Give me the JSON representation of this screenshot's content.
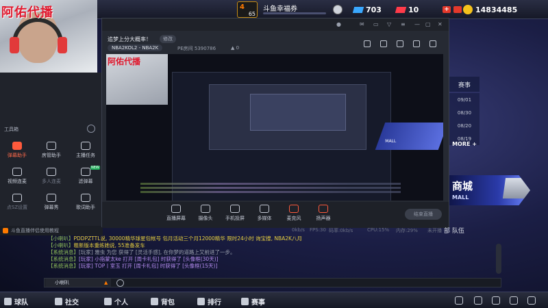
{
  "topbar": {
    "level": "65",
    "event_title": "斗鱼幸福券",
    "stat_blue": "703",
    "stat_red": "10",
    "coins": "14834485",
    "colors": {
      "coin": "#f4c21c",
      "ticket_blue": "#3aa8ff",
      "ticket_red": "#ff3b4a"
    }
  },
  "facecam": {
    "overlay_text": "阿佑代播"
  },
  "tool_panel": {
    "header": "工具箱",
    "tools": [
      {
        "label": "弹幕助手",
        "icon": "danmaku-icon",
        "highlight": true,
        "tag": ""
      },
      {
        "label": "房管助手",
        "icon": "admin-icon",
        "highlight": false,
        "tag": ""
      },
      {
        "label": "主播任务",
        "icon": "task-icon",
        "highlight": false,
        "tag": ""
      },
      {
        "label": "视频连麦",
        "icon": "video-link-icon",
        "highlight": false,
        "tag": ""
      },
      {
        "label": "多人连麦",
        "icon": "multi-link-icon",
        "highlight": false,
        "tag": "",
        "dim": true
      },
      {
        "label": "滤弹幕",
        "icon": "filter-icon",
        "highlight": false,
        "tag": "NEW"
      },
      {
        "label": "点SZ设置",
        "icon": "settings-icon",
        "highlight": false,
        "tag": "",
        "dim": true
      },
      {
        "label": "弹幕秀",
        "icon": "show-icon",
        "highlight": false,
        "tag": ""
      },
      {
        "label": "歌词助手",
        "icon": "lyrics-icon",
        "highlight": false,
        "tag": ""
      }
    ],
    "tipbar": "斗鱼直播伴侣使用教程"
  },
  "stream_window": {
    "room_title": "追梦上分大概率！",
    "edit_label": "修改",
    "category": "NBA2KOL2 - NBA2K",
    "room_id_label": "PE房间",
    "room_id": "5390786",
    "heat": "0",
    "toolbar": [
      {
        "label": "直播屏幕",
        "icon": "screen-icon"
      },
      {
        "label": "摄像头",
        "icon": "camera-icon"
      },
      {
        "label": "手机投屏",
        "icon": "phone-cast-icon"
      },
      {
        "label": "多媒体",
        "icon": "media-icon"
      },
      {
        "label": "麦克风",
        "icon": "mic-icon"
      },
      {
        "label": "扬声器",
        "icon": "speaker-icon"
      }
    ],
    "start_label": "结束直播"
  },
  "game_right": {
    "tab_label": "赛事",
    "dates": [
      "09/01",
      "08/30",
      "08/20",
      "08/19"
    ],
    "more_label": "MORE +",
    "mall_title": "商城",
    "mall_sub": "MALL",
    "preview_mall": "MALL"
  },
  "status_row": {
    "net": "0kb/s",
    "fps": "FPS:30",
    "bitrate": "码率:0kb/s",
    "cpu": "CPU:15%",
    "mem": "内存:29%",
    "state": "未开播",
    "teams": "部 队伍"
  },
  "chat": {
    "lines": [
      {
        "tag": "【小喇叭】",
        "tag_class": "tag-user",
        "text": "PDDPZTTL说, 30000精华球星包帐号 包月活动三个月12000精华 限时24小时 询宝搜, NBA2K八月",
        "cls": "msg-yellow"
      },
      {
        "tag": "【小喇叭】",
        "tag_class": "tag-user",
        "text": "粗新版本重练她说, 55准备发车",
        "cls": "msg-yellow"
      },
      {
        "tag": "【系统消息】",
        "tag_class": "tag-sys",
        "text": "[玩家] 雅虫 为您 获得了 [灵活手感], 在你梦的道路上又前进了一步。",
        "cls": "msg-gray"
      },
      {
        "tag": "【系统消息】",
        "tag_class": "tag-sys",
        "text": "[玩家] 小指蒙太ke 打开 [周卡礼包] 时获得了 [头像框(30天)]",
        "cls": "msg-purple"
      },
      {
        "tag": "【系统消息】",
        "tag_class": "tag-sys",
        "text": "[玩家] TOP丨室玉 打开 [周卡礼包] 时获得了 [头像框(15天)]",
        "cls": "msg-purple"
      }
    ],
    "channel": "小喇叭"
  },
  "bottom_nav": {
    "items": [
      {
        "label": "球队",
        "icon": "team-icon"
      },
      {
        "label": "社交",
        "icon": "social-icon"
      },
      {
        "label": "个人",
        "icon": "profile-icon"
      },
      {
        "label": "背包",
        "icon": "bag-icon"
      },
      {
        "label": "排行",
        "icon": "rank-icon"
      },
      {
        "label": "赛事",
        "icon": "match-icon"
      }
    ]
  }
}
